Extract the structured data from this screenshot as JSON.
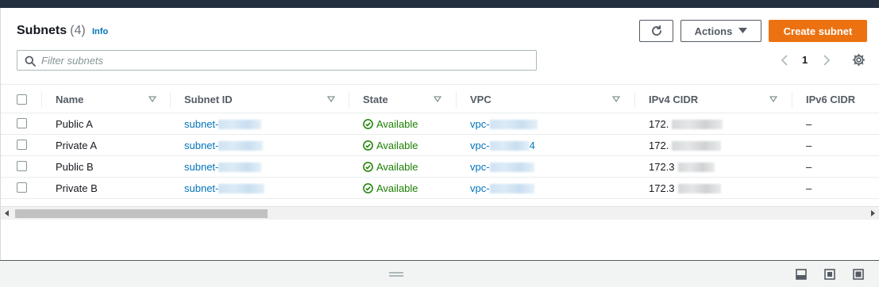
{
  "header": {
    "title": "Subnets",
    "count": "(4)",
    "info": "Info"
  },
  "toolbar": {
    "refresh_icon": "refresh-icon",
    "actions_label": "Actions",
    "create_label": "Create subnet"
  },
  "search": {
    "placeholder": "Filter subnets",
    "value": ""
  },
  "pagination": {
    "current_page": "1"
  },
  "table": {
    "columns": [
      "Name",
      "Subnet ID",
      "State",
      "VPC",
      "IPv4 CIDR",
      "IPv6 CIDR"
    ],
    "rows": [
      {
        "name": "Public A",
        "subnet_id_prefix": "subnet-",
        "state": "Available",
        "vpc_prefix": "vpc-",
        "vpc_suffix": "",
        "ipv4_prefix": "172.",
        "ipv6": "–"
      },
      {
        "name": "Private A",
        "subnet_id_prefix": "subnet-",
        "state": "Available",
        "vpc_prefix": "vpc-",
        "vpc_suffix": "4",
        "ipv4_prefix": "172.",
        "ipv6": "–"
      },
      {
        "name": "Public B",
        "subnet_id_prefix": "subnet-",
        "state": "Available",
        "vpc_prefix": "vpc-",
        "vpc_suffix": "",
        "ipv4_prefix": "172.3",
        "ipv6": "–"
      },
      {
        "name": "Private B",
        "subnet_id_prefix": "subnet-",
        "state": "Available",
        "vpc_prefix": "vpc-",
        "vpc_suffix": "",
        "ipv4_prefix": "172.3",
        "ipv6": "–"
      }
    ]
  },
  "colors": {
    "brand_orange": "#ec7211",
    "link_blue": "#0073bb",
    "success_green": "#1d8102",
    "topbar": "#232f3e"
  }
}
